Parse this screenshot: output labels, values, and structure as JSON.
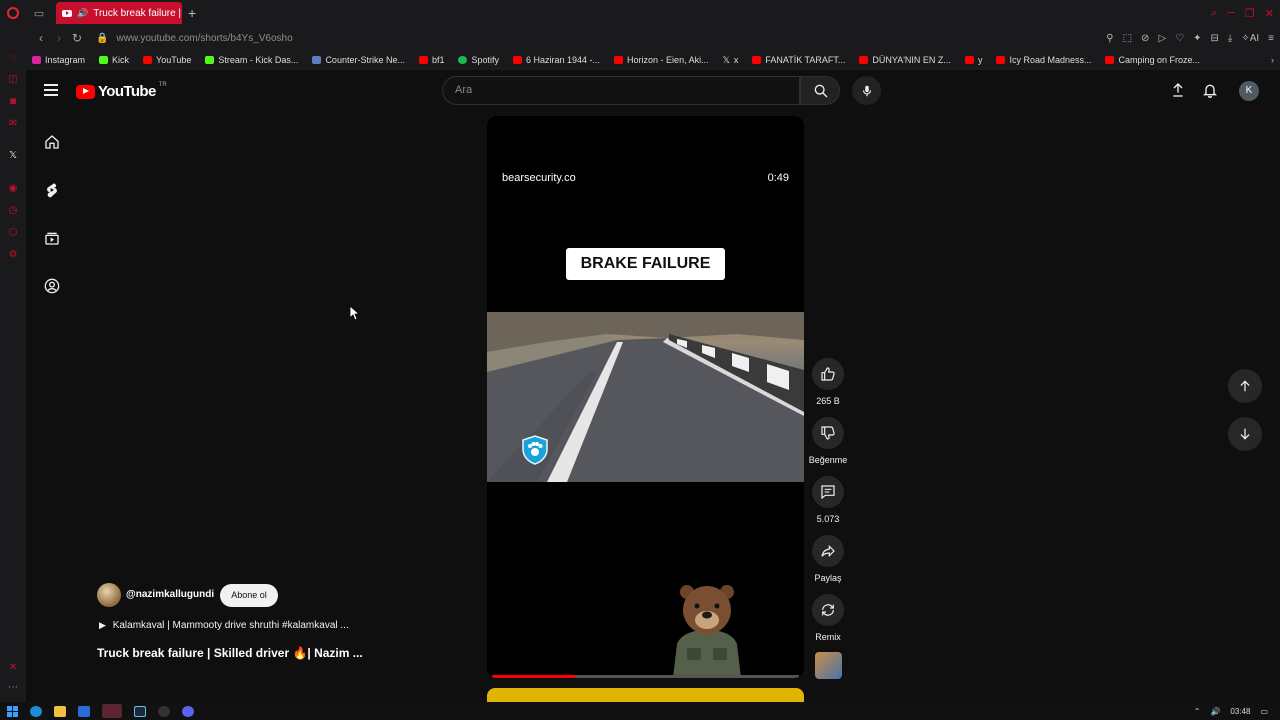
{
  "browser": {
    "tab_title": "Truck break failure | Ski",
    "url_prefix": "www.youtube.com",
    "url_path": "/shorts/b4Ys_V6osho",
    "ai_label": "AI",
    "bookmarks": [
      {
        "label": "Instagram",
        "color": "#d6249f"
      },
      {
        "label": "Kick",
        "color": "#53fc18"
      },
      {
        "label": "YouTube",
        "color": "#ff0000"
      },
      {
        "label": "Stream - Kick Das...",
        "color": "#53fc18"
      },
      {
        "label": "Counter-Strike Ne...",
        "color": "#5b7fbf"
      },
      {
        "label": "bf1",
        "color": "#ff0000"
      },
      {
        "label": "Spotify",
        "color": "#1db954"
      },
      {
        "label": "6 Haziran 1944 -...",
        "color": "#ff0000"
      },
      {
        "label": "Horizon - Eien, Aki...",
        "color": "#ff0000"
      },
      {
        "label": "x",
        "color": "#ffffff"
      },
      {
        "label": "FANATİK TARAFT...",
        "color": "#ff0000"
      },
      {
        "label": "DÜNYA'NIN EN Z...",
        "color": "#ff0000"
      },
      {
        "label": "y",
        "color": "#ff0000"
      },
      {
        "label": "Icy Road Madness...",
        "color": "#ff0000"
      },
      {
        "label": "Camping on Froze...",
        "color": "#ff0000"
      }
    ]
  },
  "youtube": {
    "logo_text": "YouTube",
    "region": "TR",
    "search_placeholder": "Ara",
    "avatar_letter": "K"
  },
  "short": {
    "watermark": "bearsecurity.co",
    "timestamp": "0:49",
    "caption": "BRAKE FAILURE",
    "progress": 0.27,
    "channel": "@nazimkallugundi",
    "subscribe_label": "Abone ol",
    "music": "Kalamkaval | Mammooty drive shruthi #kalamkaval ...",
    "title": "Truck break failure | Skilled driver 🔥| Nazim ..."
  },
  "actions": {
    "like_count": "265 B",
    "dislike_label": "Beğenme",
    "comment_count": "5.073",
    "share_label": "Paylaş",
    "remix_label": "Remix"
  },
  "system": {
    "clock": "03:48"
  }
}
